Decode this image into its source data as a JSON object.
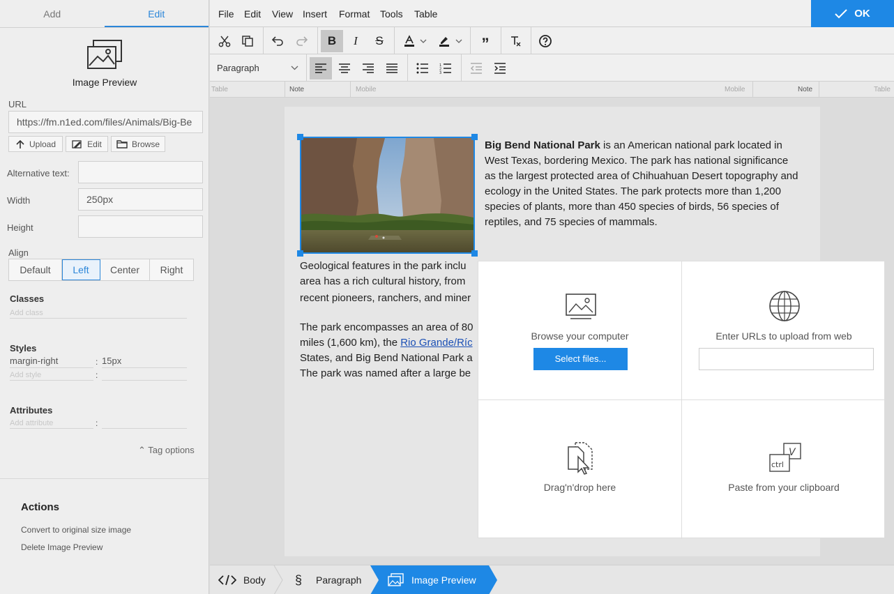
{
  "left_panel": {
    "tabs": [
      "Add",
      "Edit"
    ],
    "active_tab": "Edit",
    "preview_title": "Image Preview",
    "url_label": "URL",
    "url_value": "https://fm.n1ed.com/files/Animals/Big-Be",
    "buttons": {
      "upload": "Upload",
      "edit": "Edit",
      "browse": "Browse"
    },
    "alt_label": "Alternative text:",
    "alt_value": "",
    "width_label": "Width",
    "width_value": "250px",
    "height_label": "Height",
    "height_value": "",
    "align_label": "Align",
    "align_options": [
      "Default",
      "Left",
      "Center",
      "Right"
    ],
    "align_selected": "Left",
    "classes_label": "Classes",
    "classes_placeholder": "Add class",
    "styles_label": "Styles",
    "style_prop": "margin-right",
    "style_value": "15px",
    "style_placeholder": "Add style",
    "attributes_label": "Attributes",
    "attribute_placeholder": "Add attribute",
    "tag_options": "Tag options",
    "actions_title": "Actions",
    "actions": [
      "Convert to original size image",
      "Delete Image Preview"
    ]
  },
  "menubar": {
    "items": [
      "File",
      "Edit",
      "View",
      "Insert",
      "Format",
      "Tools",
      "Table"
    ],
    "ok_label": "OK"
  },
  "toolbar": {
    "paragraph_select": "Paragraph",
    "bold_active": true,
    "align_left_active": true
  },
  "ruler": {
    "labels": [
      "Table",
      "Note",
      "Mobile",
      "Mobile",
      "Note",
      "Table"
    ]
  },
  "content": {
    "title_bold": "Big Bend National Park",
    "para1": " is an American national park located in West Texas, bordering Mexico. The park has national significance as the largest protected area of Chihuahuan Desert topography and ecology in the United States. The park protects more than 1,200 species of plants, more than 450 species of birds, 56 species of reptiles, and 75 species of mammals.",
    "para2_lines": [
      "Geological features in the park inclu",
      "area has a rich cultural history, from",
      "recent pioneers, ranchers, and miner"
    ],
    "para3_line1": "The park encompasses an area of 80",
    "para3_line2_pre": "miles (1,600 km), the ",
    "para3_link": "Rio Grande/Ríc",
    "para3_line3": "States, and Big Bend National Park a",
    "para3_line4": "The park was named after a large be"
  },
  "upload": {
    "browse_label": "Browse your computer",
    "select_button": "Select files...",
    "url_label": "Enter URLs to upload from web",
    "url_value": "",
    "drag_label": "Drag'n'drop here",
    "paste_label": "Paste from your clipboard",
    "ctrl_text": "ctrl",
    "v_text": "V"
  },
  "breadcrumb": [
    "Body",
    "Paragraph",
    "Image Preview"
  ],
  "colors": {
    "accent": "#1e88e5",
    "panel": "#eeeeee",
    "toolbar": "#f0f0f0"
  }
}
